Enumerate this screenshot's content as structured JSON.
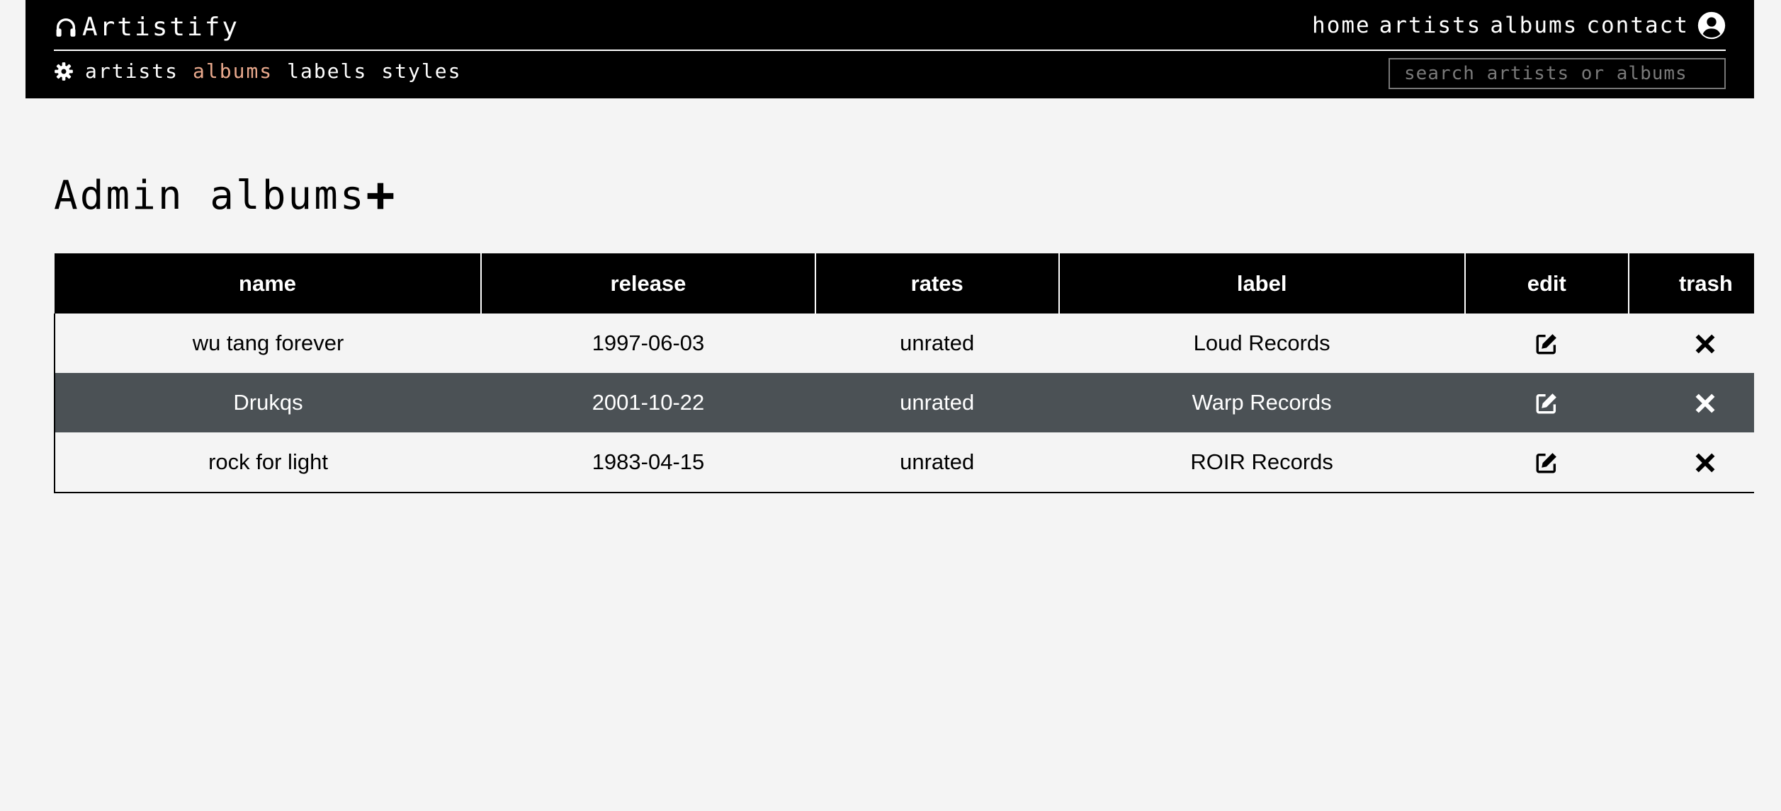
{
  "brand": {
    "name": "Artistify",
    "icon": "headphones-icon"
  },
  "top_nav": {
    "links": [
      "home",
      "artists",
      "albums",
      "contact"
    ],
    "user_icon": "user-circle-icon"
  },
  "sub_nav": {
    "icon": "gear-icon",
    "links": [
      "artists",
      "albums",
      "labels",
      "styles"
    ],
    "active": "albums",
    "active_color": "#e8a88c"
  },
  "search": {
    "placeholder": "search artists or albums",
    "value": ""
  },
  "page": {
    "title": "Admin albums",
    "add_icon": "plus-icon"
  },
  "table": {
    "columns": [
      "name",
      "release",
      "rates",
      "label",
      "edit",
      "trash"
    ],
    "rows": [
      {
        "name": "wu tang forever",
        "release": "1997-06-03",
        "rates": "unrated",
        "label": "Loud Records",
        "edit_icon": "edit-icon",
        "trash_icon": "close-icon"
      },
      {
        "name": "Drukqs",
        "release": "2001-10-22",
        "rates": "unrated",
        "label": "Warp Records",
        "edit_icon": "edit-icon",
        "trash_icon": "close-icon"
      },
      {
        "name": "rock for light",
        "release": "1983-04-15",
        "rates": "unrated",
        "label": "ROIR Records",
        "edit_icon": "edit-icon",
        "trash_icon": "close-icon"
      }
    ]
  },
  "colors": {
    "navbar": "#000000",
    "page_background": "#f4f4f4",
    "alt_row": "#4b5155"
  }
}
